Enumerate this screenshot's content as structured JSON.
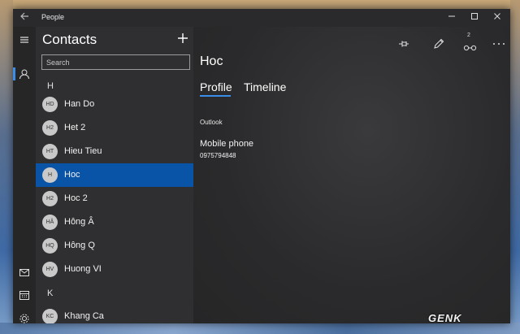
{
  "window": {
    "title": "People"
  },
  "list": {
    "title": "Contacts",
    "search_placeholder": "Search",
    "groups": [
      {
        "letter": "H",
        "contacts": [
          {
            "initials": "HD",
            "name": "Han Do"
          },
          {
            "initials": "H2",
            "name": "Het 2"
          },
          {
            "initials": "HT",
            "name": "Hieu Tieu"
          },
          {
            "initials": "H",
            "name": "Hoc",
            "selected": true
          },
          {
            "initials": "H2",
            "name": "Hoc 2"
          },
          {
            "initials": "HÂ",
            "name": "Hông Â"
          },
          {
            "initials": "HQ",
            "name": "Hông Q"
          },
          {
            "initials": "HV",
            "name": "Huong VI"
          }
        ]
      },
      {
        "letter": "K",
        "contacts": [
          {
            "initials": "KC",
            "name": "Khang Ca"
          }
        ]
      }
    ]
  },
  "detail": {
    "name": "Hoc",
    "tabs": [
      "Profile",
      "Timeline"
    ],
    "active_tab": "Profile",
    "section": "Outlook",
    "field_label": "Mobile phone",
    "field_value": "0975794848",
    "link_count": "2"
  },
  "watermark": "GENK",
  "colors": {
    "accent": "#3b8ee8",
    "selection": "#0a54a8"
  }
}
